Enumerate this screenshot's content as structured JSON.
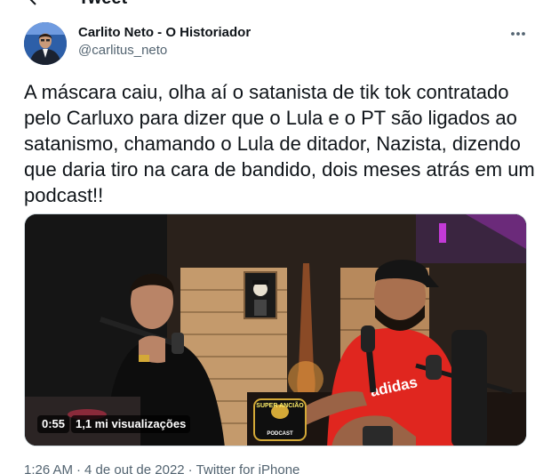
{
  "header": {
    "title": "Tweet"
  },
  "author": {
    "name": "Carlito Neto - O Historiador",
    "handle": "@carlitus_neto"
  },
  "tweet": {
    "text": "A máscara caiu, olha aí o satanista de tik tok contratado pelo Carluxo para dizer que o Lula e o PT são ligados ao satanismo, chamando o Lula de ditador, Nazista, dizendo que daria tiro na cara de bandido, dois meses atrás em um podcast!!"
  },
  "video": {
    "duration": "0:55",
    "views": "1,1 mi visualizações",
    "shirt_text": "adidas",
    "logo_text": "SUPER ANCIÃO",
    "logo_subtext": "PODCAST"
  },
  "meta": {
    "time": "1:26 AM",
    "separator": "·",
    "date": "4 de out de 2022",
    "source": "Twitter for iPhone"
  },
  "colors": {
    "text": "#0f1419",
    "secondary": "#536471",
    "shirt": "#e0261f"
  },
  "icons": {
    "back": "arrow-left-icon",
    "more": "more-horizontal-icon"
  }
}
